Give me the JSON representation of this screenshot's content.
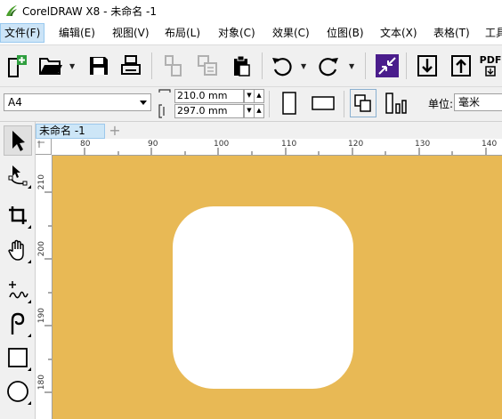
{
  "window": {
    "title": "CorelDRAW X8 - 未命名 -1"
  },
  "menu": [
    {
      "label": "文件(F)",
      "active": true
    },
    {
      "label": "编辑(E)"
    },
    {
      "label": "视图(V)"
    },
    {
      "label": "布局(L)"
    },
    {
      "label": "对象(C)"
    },
    {
      "label": "效果(C)"
    },
    {
      "label": "位图(B)"
    },
    {
      "label": "文本(X)"
    },
    {
      "label": "表格(T)"
    },
    {
      "label": "工具"
    }
  ],
  "toolbar": {
    "pdf_label": "PDF",
    "icons": [
      "new-document-icon",
      "open-folder-icon",
      "save-icon",
      "print-icon",
      "cut-icon",
      "copy-icon",
      "paste-icon",
      "undo-icon",
      "redo-icon",
      "corel-connect-icon",
      "import-icon",
      "export-icon",
      "publish-pdf-icon"
    ]
  },
  "property_bar": {
    "page_size": "A4",
    "width": "210.0 mm",
    "height": "297.0 mm",
    "units_label": "单位:",
    "units_value": "毫米",
    "spin_up": "▲",
    "spin_down": "▼"
  },
  "tools": [
    "pick-tool-icon",
    "shape-tool-icon",
    "crop-tool-icon",
    "pan-tool-icon",
    "freehand-tool-icon",
    "artistic-media-icon",
    "rectangle-tool-icon",
    "ellipse-tool-icon"
  ],
  "document_tab": {
    "label": "未命名 -1",
    "add_label": "+"
  },
  "ruler": {
    "h_labels": [
      "80",
      "90",
      "100",
      "110",
      "120",
      "130",
      "140"
    ],
    "v_labels": [
      "210",
      "200",
      "190",
      "180"
    ]
  },
  "colors": {
    "page_background": "#e8b955",
    "shape_fill": "#ffffff",
    "active_tab": "#cde6f7"
  }
}
